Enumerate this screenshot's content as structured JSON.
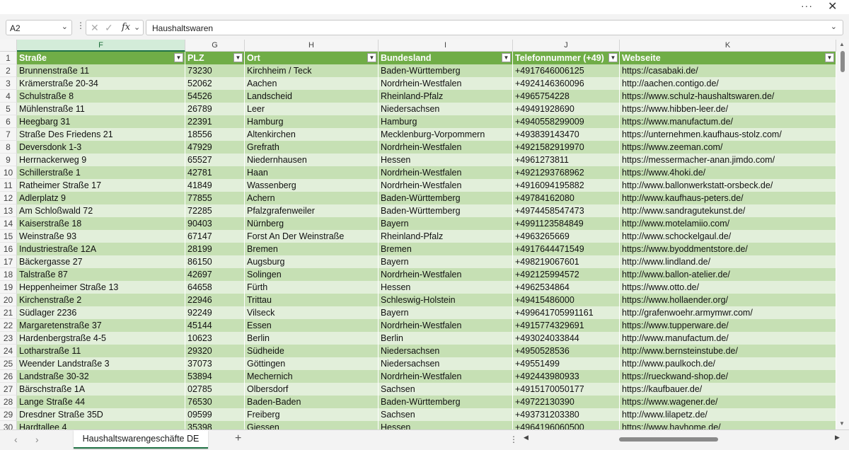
{
  "window": {
    "more_label": "···",
    "close_label": "✕"
  },
  "formula_bar": {
    "name_box": "A2",
    "name_box_dropdown": "⌄",
    "vdots": "⋮",
    "cancel_icon": "✕",
    "confirm_icon": "✓",
    "fx_label": "fx",
    "fx_dropdown": "⌄",
    "formula": "Haushaltswaren",
    "expand_icon": "⌄"
  },
  "columns": [
    {
      "letter": "F",
      "selected": true
    },
    {
      "letter": "G",
      "selected": false
    },
    {
      "letter": "H",
      "selected": false
    },
    {
      "letter": "I",
      "selected": false
    },
    {
      "letter": "J",
      "selected": false
    },
    {
      "letter": "K",
      "selected": false
    }
  ],
  "table": {
    "header_row_number": "1",
    "filter_icon": "▼",
    "headers": [
      "Straße",
      "PLZ",
      "Ort",
      "Bundesland",
      "Telefonnummer (+49)",
      "Webseite"
    ],
    "rows": [
      [
        "2",
        "Brunnenstraße 11",
        "73230",
        "Kirchheim / Teck",
        "Baden-Württemberg",
        "+4917646006125",
        "https://casabaki.de/"
      ],
      [
        "3",
        "Krämerstraße 20-34",
        "52062",
        "Aachen",
        "Nordrhein-Westfalen",
        "+4924146360096",
        "http://aachen.contigo.de/"
      ],
      [
        "4",
        "Schulstraße 8",
        "54526",
        "Landscheid",
        "Rheinland-Pfalz",
        "+4965754228",
        "https://www.schulz-haushaltswaren.de/"
      ],
      [
        "5",
        "Mühlenstraße 11",
        "26789",
        "Leer",
        "Niedersachsen",
        "+49491928690",
        "https://www.hibben-leer.de/"
      ],
      [
        "6",
        "Heegbarg 31",
        "22391",
        "Hamburg",
        "Hamburg",
        "+4940558299009",
        "https://www.manufactum.de/"
      ],
      [
        "7",
        "Straße Des Friedens 21",
        "18556",
        "Altenkirchen",
        "Mecklenburg-Vorpommern",
        "+493839143470",
        "https://unternehmen.kaufhaus-stolz.com/"
      ],
      [
        "8",
        "Deversdonk 1-3",
        "47929",
        "Grefrath",
        "Nordrhein-Westfalen",
        "+4921582919970",
        "https://www.zeeman.com/"
      ],
      [
        "9",
        "Herrnackerweg 9",
        "65527",
        "Niedernhausen",
        "Hessen",
        "+4961273811",
        "https://messermacher-anan.jimdo.com/"
      ],
      [
        "10",
        "Schillerstraße 1",
        "42781",
        "Haan",
        "Nordrhein-Westfalen",
        "+4921293768962",
        "https://www.4hoki.de/"
      ],
      [
        "11",
        "Ratheimer Straße 17",
        "41849",
        "Wassenberg",
        "Nordrhein-Westfalen",
        "+4916094195882",
        "http://www.ballonwerkstatt-orsbeck.de/"
      ],
      [
        "12",
        "Adlerplatz 9",
        "77855",
        "Achern",
        "Baden-Württemberg",
        "+49784162080",
        "http://www.kaufhaus-peters.de/"
      ],
      [
        "13",
        "Am Schloßwald 72",
        "72285",
        "Pfalzgrafenweiler",
        "Baden-Württemberg",
        "+4974458547473",
        "http://www.sandragutekunst.de/"
      ],
      [
        "14",
        "Kaiserstraße 18",
        "90403",
        "Nürnberg",
        "Bayern",
        "+4991123584849",
        "http://www.motelamiio.com/"
      ],
      [
        "15",
        "Weinstraße 93",
        "67147",
        "Forst An Der Weinstraße",
        "Rheinland-Pfalz",
        "+4963265669",
        "http://www.schockelgaul.de/"
      ],
      [
        "16",
        "Industriestraße 12A",
        "28199",
        "Bremen",
        "Bremen",
        "+4917644471549",
        "https://www.byoddmentstore.de/"
      ],
      [
        "17",
        "Bäckergasse 27",
        "86150",
        "Augsburg",
        "Bayern",
        "+498219067601",
        "http://www.lindland.de/"
      ],
      [
        "18",
        "Talstraße 87",
        "42697",
        "Solingen",
        "Nordrhein-Westfalen",
        "+492125994572",
        "http://www.ballon-atelier.de/"
      ],
      [
        "19",
        "Heppenheimer Straße 13",
        "64658",
        "Fürth",
        "Hessen",
        "+4962534864",
        "https://www.otto.de/"
      ],
      [
        "20",
        "Kirchenstraße 2",
        "22946",
        "Trittau",
        "Schleswig-Holstein",
        "+49415486000",
        "https://www.hollaender.org/"
      ],
      [
        "21",
        "Südlager 2236",
        "92249",
        "Vilseck",
        "Bayern",
        "+499641705991161",
        "http://grafenwoehr.armymwr.com/"
      ],
      [
        "22",
        "Margaretenstraße 37",
        "45144",
        "Essen",
        "Nordrhein-Westfalen",
        "+4915774329691",
        "https://www.tupperware.de/"
      ],
      [
        "23",
        "Hardenbergstraße 4-5",
        "10623",
        "Berlin",
        "Berlin",
        "+493024033844",
        "http://www.manufactum.de/"
      ],
      [
        "24",
        "Lotharstraße 11",
        "29320",
        "Südheide",
        "Niedersachsen",
        "+4950528536",
        "http://www.bernsteinstube.de/"
      ],
      [
        "25",
        "Weender Landstraße 3",
        "37073",
        "Göttingen",
        "Niedersachsen",
        "+49551499",
        "http://www.paulkoch.de/"
      ],
      [
        "26",
        "Landstraße 30-32",
        "53894",
        "Mechernich",
        "Nordrhein-Westfalen",
        "+492443980933",
        "https://rueckwand-shop.de/"
      ],
      [
        "27",
        "Bärschstraße 1A",
        "02785",
        "Olbersdorf",
        "Sachsen",
        "+4915170050177",
        "https://kaufbauer.de/"
      ],
      [
        "28",
        "Lange Straße 44",
        "76530",
        "Baden-Baden",
        "Baden-Württemberg",
        "+49722130390",
        "https://www.wagener.de/"
      ],
      [
        "29",
        "Dresdner Straße 35D",
        "09599",
        "Freiberg",
        "Sachsen",
        "+493731203380",
        "http://www.lilapetz.de/"
      ],
      [
        "30",
        "Hardtallee 4",
        "35398",
        "Giessen",
        "Hessen",
        "+4964196060500",
        "https://www.hayhome.de/"
      ]
    ]
  },
  "sheets": {
    "prev_icon": "‹",
    "next_icon": "›",
    "active_tab": "Haushaltswarengeschäfte DE",
    "add_icon": "+",
    "hdots": "⋮",
    "scroll_left": "◀",
    "scroll_right": "▶"
  },
  "vscroll": {
    "up": "▲",
    "down": "▼"
  }
}
